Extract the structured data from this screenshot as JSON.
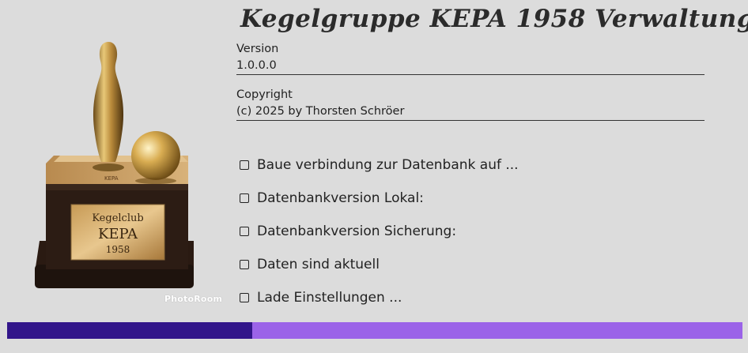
{
  "header": {
    "title": "Kegelgruppe KEPA 1958 Verwaltung"
  },
  "trophy": {
    "plate_line1": "Kegelclub",
    "plate_line2": "KEPA",
    "plate_line3": "1958",
    "small_text": "KEPA",
    "watermark": "PhotoRoom"
  },
  "version": {
    "label": "Version",
    "value": "1.0.0.0"
  },
  "copyright": {
    "label": "Copyright",
    "value": "(c) 2025 by Thorsten Schröer"
  },
  "status_items": [
    {
      "label": "Baue verbindung zur Datenbank auf ...",
      "checked": false
    },
    {
      "label": "Datenbankversion Lokal:",
      "checked": false
    },
    {
      "label": "Datenbankversion Sicherung:",
      "checked": false
    },
    {
      "label": "Daten sind aktuell",
      "checked": false
    },
    {
      "label": "Lade Einstellungen ...",
      "checked": false
    }
  ],
  "progress": {
    "fraction": 0.333
  },
  "colors": {
    "background": "#dcdcdc",
    "progress_fill": "#32158a",
    "progress_track": "#9b63e8"
  }
}
